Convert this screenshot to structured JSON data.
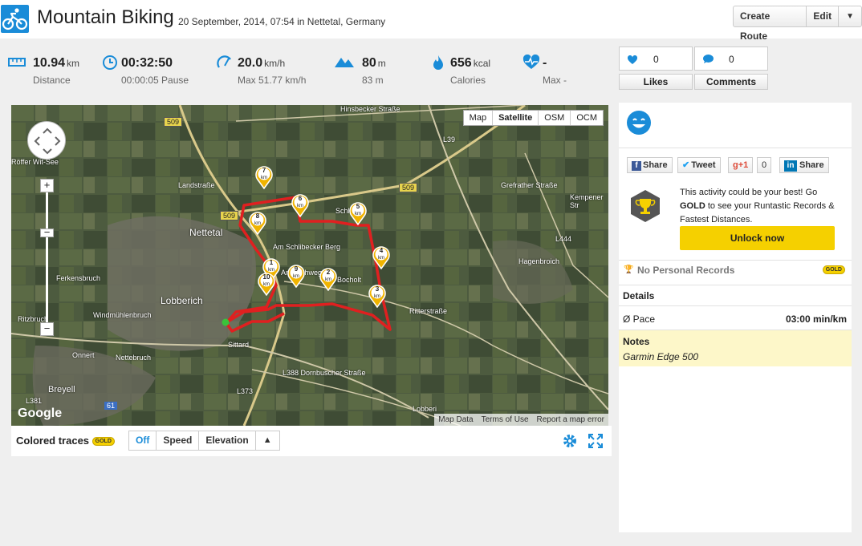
{
  "header": {
    "title": "Mountain Biking",
    "subtitle": "20 September, 2014, 07:54 in Nettetal, Germany",
    "create_route": "Create Route",
    "edit": "Edit",
    "dropdown": "▼"
  },
  "stats": [
    {
      "icon": "distance-icon",
      "value": "10.94",
      "unit": "km",
      "label": "Distance"
    },
    {
      "icon": "clock-icon",
      "value": "00:32:50",
      "unit": "",
      "label": "00:00:05 Pause"
    },
    {
      "icon": "speed-icon",
      "value": "20.0",
      "unit": "km/h",
      "label": "Max 51.77 km/h"
    },
    {
      "icon": "elevation-icon",
      "value": "80",
      "unit": "m",
      "label": "83 m"
    },
    {
      "icon": "flame-icon",
      "value": "656",
      "unit": "kcal",
      "label": "Calories"
    },
    {
      "icon": "heart-rate-icon",
      "value": "-",
      "unit": "",
      "label": "Max -"
    }
  ],
  "social": {
    "likes_count": "0",
    "comments_count": "0",
    "likes_label": "Likes",
    "comments_label": "Comments"
  },
  "map": {
    "types": [
      "Map",
      "Satellite",
      "OSM",
      "OCM"
    ],
    "active_type": "Satellite",
    "zoom_in": "+",
    "zoom_out": "−",
    "attribution": [
      "Map Data",
      "Terms of Use",
      "Report a map error"
    ],
    "google": "Google",
    "places": [
      {
        "name": "Nettetal",
        "big": true
      },
      {
        "name": "Lobberich",
        "big": true
      },
      {
        "name": "Hinsbecker Straße",
        "big": false
      },
      {
        "name": "Hagenbroich",
        "big": false
      },
      {
        "name": "Ferkensbruch",
        "big": false
      },
      {
        "name": "Windmühlenbruch",
        "big": false
      },
      {
        "name": "Ritzbruch",
        "big": false
      },
      {
        "name": "Onnert",
        "big": false
      },
      {
        "name": "Nettebruch",
        "big": false
      },
      {
        "name": "Breyell",
        "big": false
      },
      {
        "name": "Sittard",
        "big": false
      },
      {
        "name": "Ritterstraße",
        "big": false
      },
      {
        "name": "Bocholt",
        "big": false
      },
      {
        "name": "L388 Dornbuscher Straße",
        "big": false
      },
      {
        "name": "Landstraße",
        "big": false
      },
      {
        "name": "Grefrather Straße",
        "big": false
      },
      {
        "name": "Am Schlibecker Berg",
        "big": false
      },
      {
        "name": "Schlibeck",
        "big": false
      },
      {
        "name": "An-Kirchweg",
        "big": false
      },
      {
        "name": "Lobberi",
        "big": false
      },
      {
        "name": "L39",
        "big": false
      },
      {
        "name": "L373",
        "big": false
      },
      {
        "name": "L444",
        "big": false
      },
      {
        "name": "L381",
        "big": false
      },
      {
        "name": "Kempener Str",
        "big": false
      },
      {
        "name": "Röffer Wit-See",
        "big": false
      },
      {
        "name": "509",
        "big": false
      },
      {
        "name": "61",
        "big": false
      }
    ],
    "markers": [
      "1",
      "2",
      "3",
      "4",
      "5",
      "6",
      "7",
      "8",
      "9",
      "10"
    ],
    "marker_unit": "km"
  },
  "controls": {
    "label": "Colored traces",
    "gold": "GOLD",
    "options": [
      "Off",
      "Speed",
      "Elevation",
      "▲"
    ],
    "active": "Off"
  },
  "sidebar": {
    "share_fb": "Share",
    "tweet": "Tweet",
    "gplus": "g+1",
    "gplus_count": "0",
    "share_in": "Share",
    "gold_text_1": "This activity could be your best! Go ",
    "gold_text_bold": "GOLD",
    "gold_text_2": " to see your Runtastic Records & Fastest Distances.",
    "unlock": "Unlock now",
    "no_records": "No Personal Records",
    "gold": "GOLD",
    "details_title": "Details",
    "pace_label": "Ø Pace",
    "pace_value": "03:00 min/km",
    "notes_title": "Notes",
    "notes_text": "Garmin Edge 500"
  },
  "colors": {
    "accent": "#1a8cd8",
    "gold": "#f5d000",
    "route": "#e02020",
    "notes_bg": "#fdf7c9"
  }
}
